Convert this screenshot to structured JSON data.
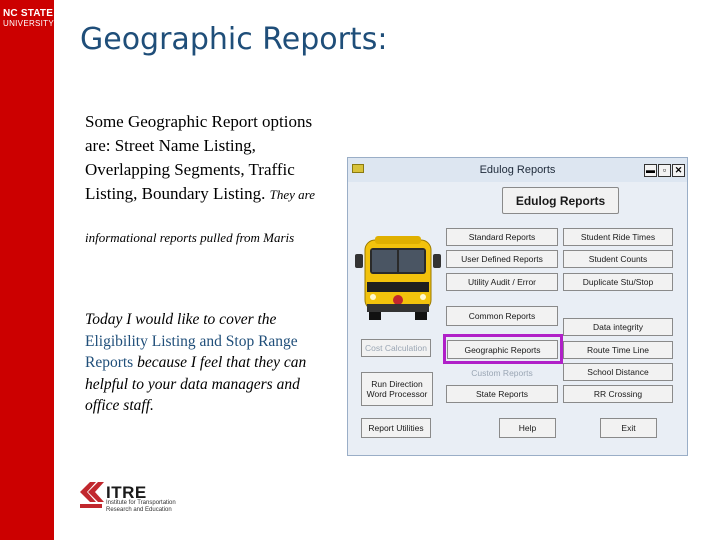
{
  "logo": {
    "line1": "NC STATE",
    "line2": "UNIVERSITY"
  },
  "title": "Geographic Reports:",
  "paragraph1": {
    "main": "Some Geographic Report options are:  Street Name Listing, Overlapping Segments, Traffic Listing, Boundary Listing.",
    "small_start": "They are",
    "small_rest": "informational reports pulled from Maris"
  },
  "paragraph2": {
    "part1": "Today I would like to cover the ",
    "highlight": "Eligibility Listing and Stop Range Reports",
    "part2": " because I feel that they can helpful to your data managers and office staff."
  },
  "window": {
    "title": "Edulog Reports",
    "controls": {
      "minimize": "▬",
      "restore": "▫",
      "close": "✕"
    },
    "header_button": "Edulog Reports",
    "buttons": {
      "standard_reports": "Standard Reports",
      "student_ride_times": "Student Ride Times",
      "user_defined_reports": "User Defined Reports",
      "student_counts": "Student Counts",
      "utility_audit_error": "Utility Audit / Error",
      "duplicate_stu_stop": "Duplicate Stu/Stop",
      "common_reports": "Common Reports",
      "data_integrity": "Data integrity",
      "cost_calculation": "Cost Calculation",
      "geographic_reports": "Geographic Reports",
      "route_time_line": "Route Time Line",
      "custom_reports": "Custom Reports",
      "school_distance": "School Distance",
      "run_direction_word_processor": "Run Direction Word Processor",
      "state_reports": "State Reports",
      "rr_crossing": "RR Crossing",
      "report_utilities": "Report Utilities",
      "help": "Help",
      "exit": "Exit"
    }
  },
  "footer_logo": {
    "name": "ITRE",
    "line1": "Institute for Transportation",
    "line2": "Research and Education"
  },
  "colors": {
    "red_bar": "#cc0000",
    "title": "#1f4e79",
    "highlight_box": "#b020c8"
  }
}
